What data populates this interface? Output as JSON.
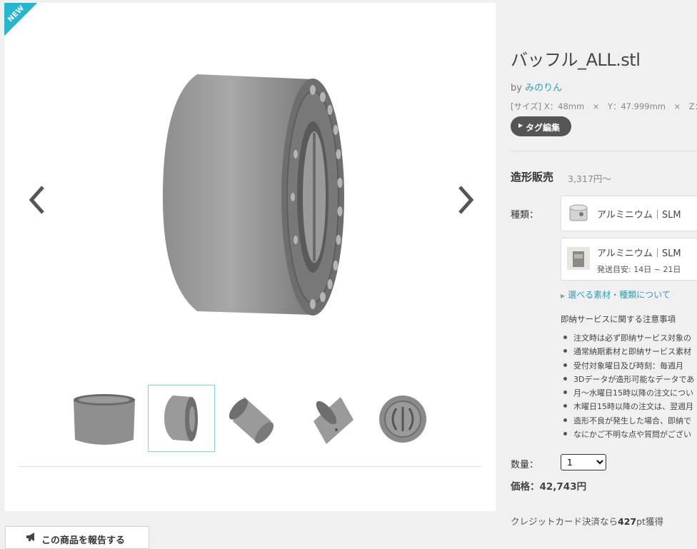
{
  "viewer": {
    "badge": "NEW",
    "prev_label": "previous-image",
    "next_label": "next-image",
    "thumbnail_count": 5,
    "active_thumbnail": 2
  },
  "product": {
    "title": "バッフル_ALL.stl",
    "by_prefix": "by",
    "author": "みのりん",
    "size_text": "[サイズ] X：48mm　×　Y：47.999mm　×　Z：",
    "tag_button": "タグ編集"
  },
  "sale": {
    "heading": "造形販売",
    "from_price": "3,317円〜",
    "kind_label": "種類：",
    "options": [
      {
        "material": "アルミニウム｜SLM"
      },
      {
        "material": "アルミニウム｜SLM",
        "shipping": "発送目安: 14日 ~ 21日"
      }
    ],
    "materials_link": "選べる素材・種類について",
    "notice_title": "即納サービスに関する注意事項",
    "notices": [
      "注文時は必ず即納サービス対象の",
      "通常納期素材と即納サービス素材",
      "受付対象曜日及び時刻：毎週月",
      "3Dデータが造形可能なデータであ",
      "月〜水曜日15時以降の注文につい",
      "木曜日15時以降の注文は、翌週月",
      "造形不良が発生した場合、即納で",
      "なにかご不明な点や質問がござい"
    ],
    "qty_label": "数量：",
    "qty_value": "1",
    "price_label": "価格：",
    "price": "42,743円",
    "credit_prefix": "クレジットカード決済なら",
    "credit_points": "427",
    "credit_suffix": "pt獲得"
  },
  "report": {
    "label": "この商品を報告する",
    "icon": "megaphone-icon"
  },
  "colors": {
    "accent": "#2a9fb5",
    "ribbon": "#28b6cf",
    "tag_button": "#555555"
  }
}
